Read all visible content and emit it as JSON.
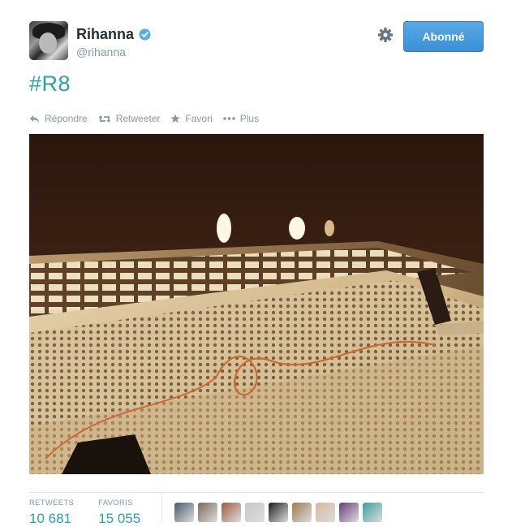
{
  "user": {
    "fullname": "Rihanna",
    "screenname": "@rihanna",
    "verified": true
  },
  "follow_button": {
    "label": "Abonné"
  },
  "tweet": {
    "text": "#R8"
  },
  "actions": [
    {
      "icon": "reply-icon",
      "label": "Répondre"
    },
    {
      "icon": "retweet-icon",
      "label": "Retweeter"
    },
    {
      "icon": "star-icon",
      "label": "Favori"
    },
    {
      "icon": "more-icon",
      "label": "Plus"
    }
  ],
  "stats": {
    "retweets_label": "RETWEETS",
    "retweets_value": "10 681",
    "favorites_label": "FAVORIS",
    "favorites_value": "15 055"
  },
  "favoriters": [
    {
      "color": "#4a5a6a"
    },
    {
      "color": "#7b6a5a"
    },
    {
      "color": "#a05a40"
    },
    {
      "color": "#c8c8c8"
    },
    {
      "color": "#1e1e1e"
    },
    {
      "color": "#9b7a50"
    },
    {
      "color": "#d8b8a0"
    },
    {
      "color": "#6a3a7a"
    },
    {
      "color": "#3aa0a0"
    }
  ],
  "colors": {
    "accent": "#2aa3a3",
    "follow_blue": "#4a9ee0",
    "verified_blue": "#55acee",
    "muted": "#8899a6"
  }
}
